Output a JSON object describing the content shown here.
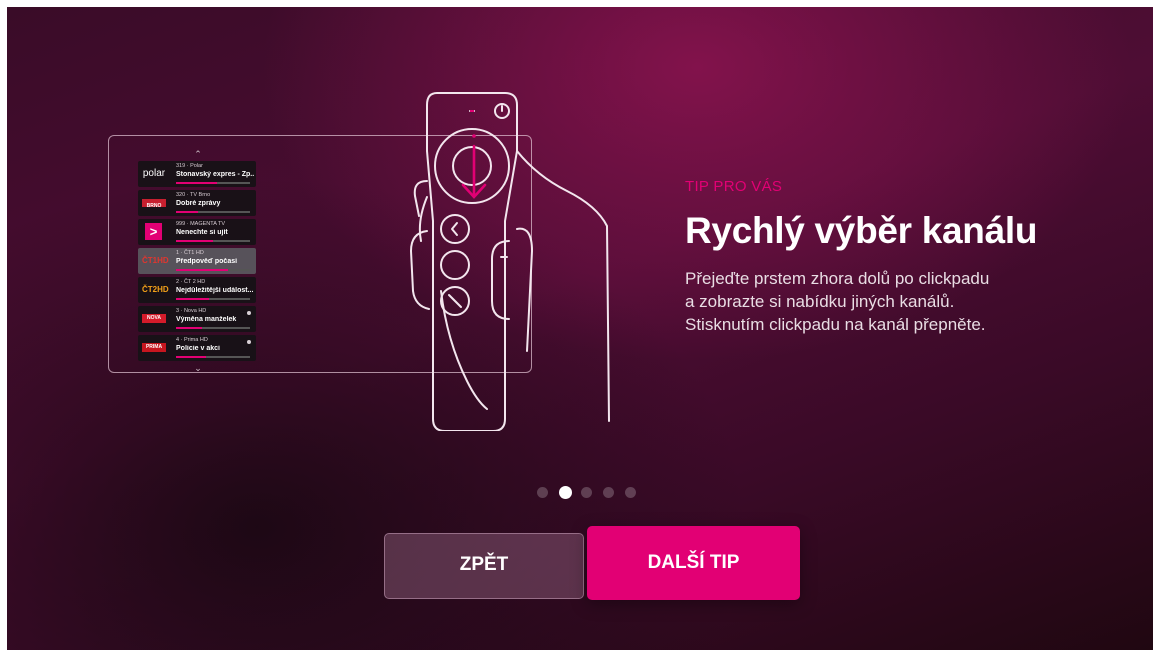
{
  "tip": {
    "eyebrow": "TIP PRO VÁS",
    "title": "Rychlý výběr kanálu",
    "description_lines": [
      "Přejeďte prstem zhora dolů po clickpadu",
      "a zobrazte si nabídku jiných  kanálů.",
      "Stisknutím clickpadu na kanál přepněte."
    ]
  },
  "channel_list": {
    "up_arrow": "⌃",
    "down_arrow": "⌄",
    "channels": [
      {
        "logo": "polar",
        "number": "319",
        "station": "Polar",
        "program": "Stonavský expres - Zp...",
        "progress": 0.55,
        "selected": false,
        "recording": false
      },
      {
        "logo": "BRNO",
        "number": "320",
        "station": "TV Brno",
        "program": "Dobré zprávy",
        "progress": 0.3,
        "selected": false,
        "recording": false
      },
      {
        "logo": ">",
        "number": "999",
        "station": "MAGENTA TV",
        "program": "Nenechte si ujít",
        "progress": 0.5,
        "selected": false,
        "recording": false
      },
      {
        "logo": "ČT1HD",
        "number": "1",
        "station": "ČT1 HD",
        "program": "Předpověď počasí",
        "progress": 0.7,
        "selected": true,
        "recording": false
      },
      {
        "logo": "ČT2HD",
        "number": "2",
        "station": "ČT 2 HD",
        "program": "Nejdůležitější událost...",
        "progress": 0.45,
        "selected": false,
        "recording": false
      },
      {
        "logo": "NOVA",
        "number": "3",
        "station": "Nova HD",
        "program": "Výměna manželek",
        "progress": 0.35,
        "selected": false,
        "recording": true
      },
      {
        "logo": "PRIMA",
        "number": "4",
        "station": "Prima HD",
        "program": "Policie v akci",
        "progress": 0.4,
        "selected": false,
        "recording": true
      }
    ]
  },
  "pagination": {
    "count": 5,
    "active_index": 1
  },
  "buttons": {
    "back_label": "ZPĚT",
    "next_label": "DALŠÍ TIP"
  },
  "colors": {
    "accent": "#e20074",
    "background": "#4e0d34"
  }
}
